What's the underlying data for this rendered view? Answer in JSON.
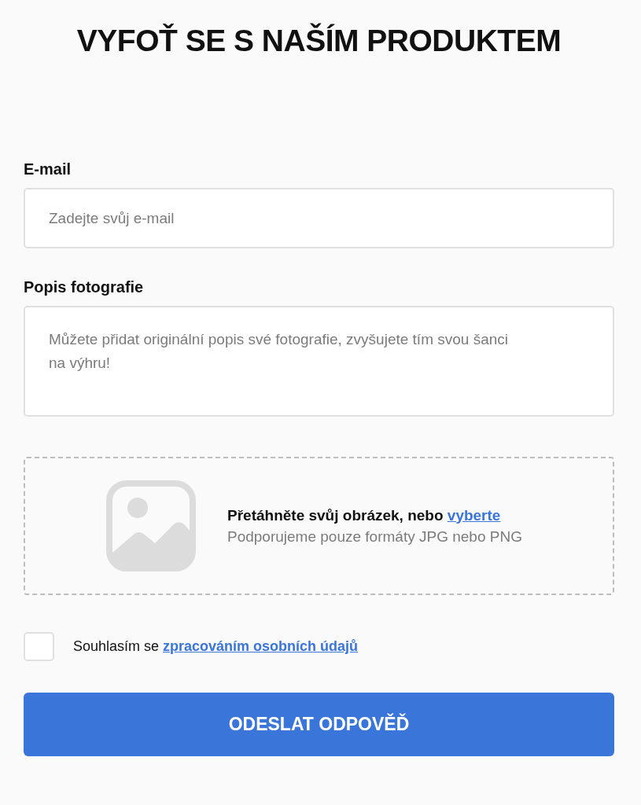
{
  "title": "VYFOŤ SE S NAŠÍM PRODUKTEM",
  "fields": [
    {
      "kind": "input",
      "label": "E-mail",
      "placeholder": "Zadejte svůj e-mail"
    },
    {
      "kind": "textarea",
      "label": "Popis fotografie",
      "placeholder": "Můžete přidat originální popis své fotografie, zvyšujete tím svou šanci na výhru!"
    }
  ],
  "upload": {
    "prompt": "Přetáhněte svůj obrázek, nebo",
    "link": "vyberte",
    "hint": "Podporujeme pouze formáty JPG nebo PNG"
  },
  "consent": {
    "text": "Souhlasím se",
    "link": "zpracováním osobních údajů",
    "checked": false
  },
  "submit": "ODESLAT ODPOVĚĎ"
}
